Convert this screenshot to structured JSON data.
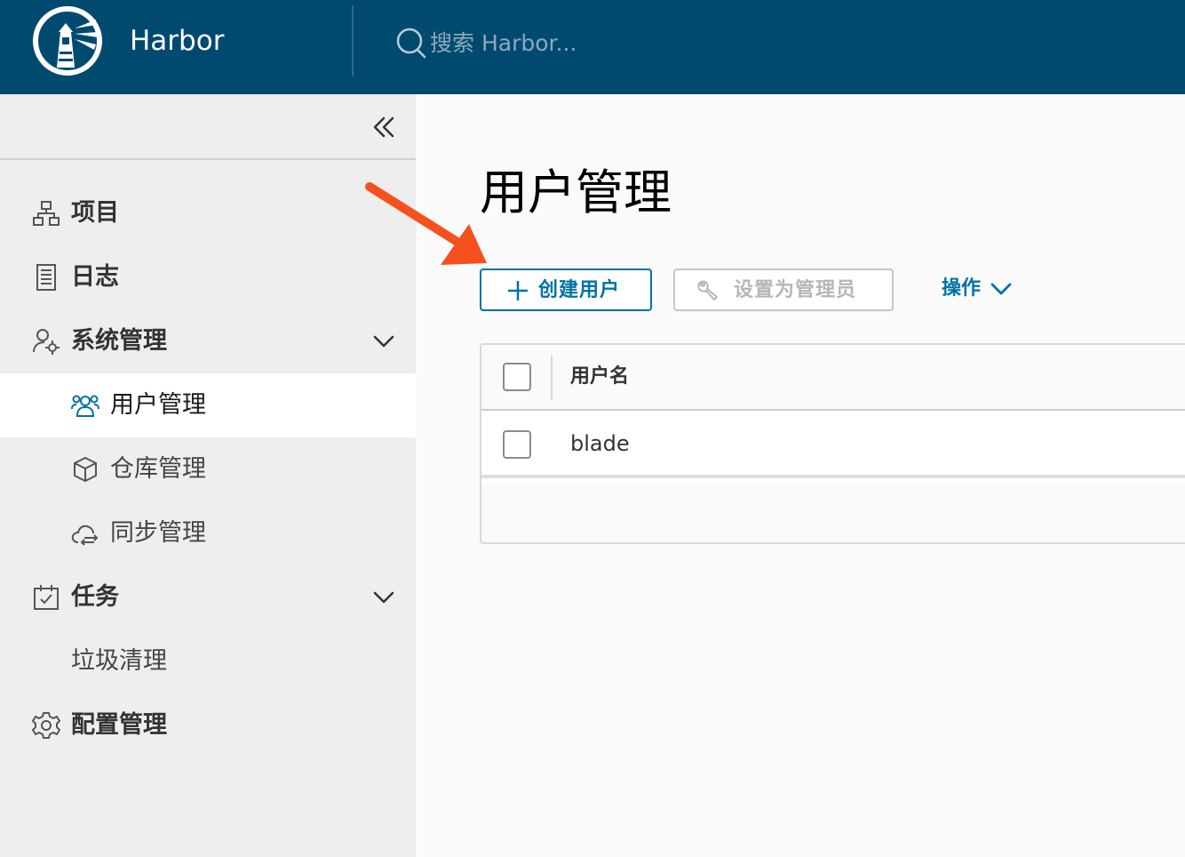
{
  "header": {
    "brand": "Harbor",
    "search_placeholder": "搜索 Harbor...",
    "logo_icon": "harbor-lighthouse-icon",
    "search_icon": "search-icon"
  },
  "sidebar": {
    "collapse_icon": "double-chevron-left-icon",
    "items": [
      {
        "label": "项目",
        "icon": "projects-icon"
      },
      {
        "label": "日志",
        "icon": "logs-icon"
      },
      {
        "label": "系统管理",
        "icon": "user-settings-icon",
        "expanded": true
      },
      {
        "label": "用户管理",
        "icon": "users-icon",
        "active": true
      },
      {
        "label": "仓库管理",
        "icon": "cube-icon"
      },
      {
        "label": "同步管理",
        "icon": "cloud-sync-icon"
      },
      {
        "label": "任务",
        "icon": "calendar-check-icon",
        "expanded": true
      },
      {
        "label": "垃圾清理"
      },
      {
        "label": "配置管理",
        "icon": "gear-icon"
      }
    ]
  },
  "main": {
    "title": "用户管理",
    "create_button": "创建用户",
    "set_admin_button": "设置为管理员",
    "actions_label": "操作",
    "table": {
      "columns": [
        "用户名"
      ],
      "rows": [
        {
          "username": "blade"
        }
      ]
    }
  },
  "colors": {
    "header_bg": "#004a70",
    "accent": "#0072a3",
    "sidebar_bg": "#eeeeee",
    "annotation_arrow": "#f5501e"
  }
}
